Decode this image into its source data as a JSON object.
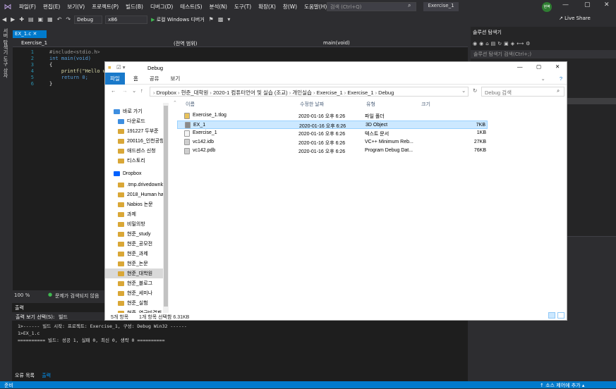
{
  "vs": {
    "menus": [
      "파일(F)",
      "편집(E)",
      "보기(V)",
      "프로젝트(P)",
      "빌드(B)",
      "디버그(D)",
      "테스트(S)",
      "분석(N)",
      "도구(T)",
      "확장(X)",
      "창(W)",
      "도움말(H)"
    ],
    "search_placeholder": "검색 (Ctrl+Q)",
    "solution_name": "Exercise_1",
    "avatar": "현벽",
    "config": "Debug",
    "platform": "x86",
    "run_label": "로컬 Windows 디버거",
    "live_share": "Live Share",
    "left_strip": [
      "서버 탐색기",
      "도구 상자"
    ],
    "editor_tab": "EX_1.c",
    "nav_project": "Exercise_1",
    "nav_scope": "(전역 범위)",
    "nav_function": "main(void)",
    "code_lines": [
      {
        "n": "1",
        "text": "#include<stdio.h>"
      },
      {
        "n": "2",
        "text": "int main(void)"
      },
      {
        "n": "3",
        "text": "{"
      },
      {
        "n": "4",
        "text": "    printf(\"Hello wo"
      },
      {
        "n": "5",
        "text": "    return 0;"
      },
      {
        "n": "6",
        "text": "}"
      }
    ],
    "zoom": "100 %",
    "no_issues": "문제가 검색되지 않음",
    "output_title": "출력",
    "output_source_label": "출력 보기 선택(S):",
    "output_source": "빌드",
    "output_lines": [
      "1>------ 빌드 시작: 프로젝트: Exercise_1, 구성: Debug Win32 ------",
      "1>EX_1.c",
      "========== 빌드: 성공 1, 실패 0, 최신 0, 생략 0 =========="
    ],
    "bottom_tabs": [
      "오류 목록",
      "출력"
    ],
    "status_ready": "준비",
    "status_right": "↑ 소스 제어에 추가 ▴",
    "solution_explorer_title": "솔루션 탐색기",
    "solution_search": "솔루션 탐색기 검색(Ctrl+;)"
  },
  "explorer": {
    "title": "Debug",
    "ribbon_tabs": [
      "파일",
      "홈",
      "공유",
      "보기"
    ],
    "breadcrumb": [
      "Dropbox",
      "현준_대학원",
      "2020-1 컴퓨터언어 및 실습 (조교)",
      "개인실습",
      "Exercise_1",
      "Exercise_1",
      "Debug"
    ],
    "search_placeholder": "Debug 검색",
    "columns": {
      "name": "이름",
      "date": "수정한 날짜",
      "type": "유형",
      "size": "크기"
    },
    "nav_items": [
      {
        "label": "바로 가기",
        "color": "#3d8ee0"
      },
      {
        "label": "다운로드",
        "color": "#3d8ee0"
      },
      {
        "label": "191227 두부준",
        "color": "#d9a737"
      },
      {
        "label": "200116_인천공항",
        "color": "#d9a737"
      },
      {
        "label": "애드센스 신청",
        "color": "#d9a737"
      },
      {
        "label": "티스토리",
        "color": "#d9a737"
      },
      {
        "label": "Dropbox",
        "color": "#0061fe"
      },
      {
        "label": ".tmp.drivedownlc",
        "color": "#d9a737"
      },
      {
        "label": "2018_Human ha",
        "color": "#d9a737"
      },
      {
        "label": "Nabios 논문",
        "color": "#d9a737"
      },
      {
        "label": "과제",
        "color": "#d9a737"
      },
      {
        "label": "비밀의방",
        "color": "#d9a737"
      },
      {
        "label": "현준_study",
        "color": "#d9a737"
      },
      {
        "label": "현준_공모전",
        "color": "#d9a737"
      },
      {
        "label": "현준_과제",
        "color": "#d9a737"
      },
      {
        "label": "현준_논문",
        "color": "#d9a737"
      },
      {
        "label": "현준_대학원",
        "color": "#d9a737"
      },
      {
        "label": "현준_블로그",
        "color": "#d9a737"
      },
      {
        "label": "현준_세미나",
        "color": "#d9a737"
      },
      {
        "label": "현준_실험",
        "color": "#d9a737"
      },
      {
        "label": "현준_연구비결제",
        "color": "#d9a737"
      }
    ],
    "files": [
      {
        "name": "Exercise_1.tlog",
        "date": "2020-01-16 오후 6:26",
        "type": "파일 폴더",
        "size": "",
        "icon": "#e8c25a"
      },
      {
        "name": "EX_1",
        "date": "2020-01-16 오후 6:26",
        "type": "3D Object",
        "size": "7KB",
        "icon": "#8a8a8a",
        "selected": true
      },
      {
        "name": "Exercise_1",
        "date": "2020-01-16 오후 6:26",
        "type": "텍스트 문서",
        "size": "1KB",
        "icon": "#f4f4f4"
      },
      {
        "name": "vc142.idb",
        "date": "2020-01-16 오후 6:26",
        "type": "VC++ Minimum Reb...",
        "size": "27KB",
        "icon": "#cfcfcf"
      },
      {
        "name": "vc142.pdb",
        "date": "2020-01-16 오후 6:26",
        "type": "Program Debug Dat...",
        "size": "76KB",
        "icon": "#cfcfcf"
      }
    ],
    "status_count": "5개 항목",
    "status_selected": "1개 항목 선택함 6.31KB"
  }
}
